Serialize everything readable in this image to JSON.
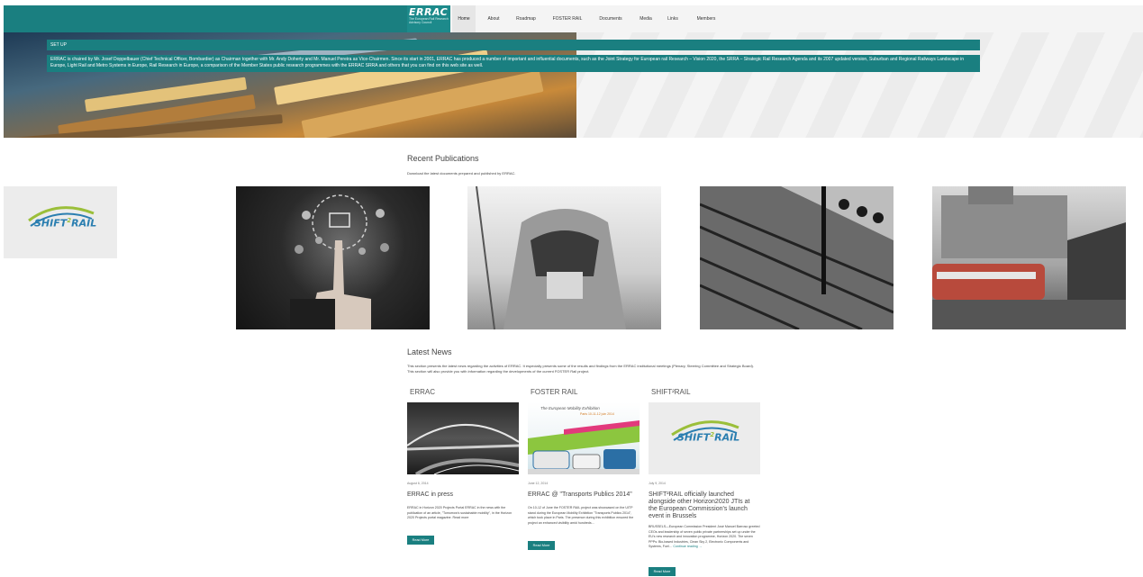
{
  "header": {
    "logo_brand": "ERRAC",
    "logo_tagline": "The European Rail Research Advisory Council",
    "nav": [
      "Home",
      "About",
      "Roadmap",
      "FOSTER RAIL",
      "Documents",
      "Media",
      "Links",
      "Members"
    ]
  },
  "hero": {
    "setup_label": "SET UP",
    "setup_text": "ERRAC is chaired by Mr. Josef Doppelbauer (Chief Technical Officer, Bombardier) as Chairman together with Mr. Andy Doherty and Mr. Manuel Pereira as Vice-Chairmen. Since its start in 2001, ERRAC has produced a number of important and influential documents, such as the Joint Strategy for European rail Research – Vision 2020, the SRRA – Strategic Rail Research Agenda and its 2007 updated version, Suburban and Regional Railways Landscape in Europe, Light Rail and Metro Systems in Europe, Rail Research in Europe, a comparison of the Member States public research programmes with the ERRAC SRRA and others that you can find on this web site as well."
  },
  "side_logo": {
    "text_main": "SHIFT",
    "text_sup": "2",
    "text_tail": "RAIL"
  },
  "publications": {
    "title": "Recent Publications",
    "subtitle": "Download the latest documents prepared and published by ERRAC."
  },
  "news": {
    "title": "Latest News",
    "intro": "This section presents the latest news regarding the activities of ERRAC. It especially presents some of the results and findings from the ERRAC institutional meetings (Plenary, Steering Committee and Strategic Board). This section will also provide you with information regarding the developments of the current FOSTER Rail project.",
    "columns": [
      {
        "head": "ERRAC",
        "date": "August 6, 2014",
        "title": "ERRAC in press",
        "body": "ERRAC in Horizon 2020 Projects Portal ERRAC in the news with the publication of an article, \"Tomorrow's sustainable mobility\", in the Horizon 2020 Projects portal magazine. Read more",
        "button": "Read More"
      },
      {
        "head": "FOSTER RAIL",
        "date": "June 12, 2014",
        "title": "ERRAC @ \"Transports Publics 2014\"",
        "body": "On 10-12 of June the FOSTER RAIL project was showcased on the UITP stand during the European Mobility Exhibition \"Transports Publics 2014\", which took place in Paris. The presence during this exhibition ensured the project an enhanced visibility amid hundreds...",
        "button": "Read More",
        "image_caption_1": "The European Mobility Exhibition",
        "image_caption_2": "Paris 10-11-12 juin 2014"
      },
      {
        "head": "SHIFT²RAIL",
        "date": "July 9, 2014",
        "title": "SHIFT²RAIL officially launched alongside other Horizon2020 JTIs at the European Commission's launch event in Brussels",
        "body": "BRUSSELS—European Commission President José Manuel Barroso greeted CEOs and leadership of seven public private partnerships set up under the EU's new research and innovation programme, Horizon 2020. The seven PPPs: Bio-based Industries, Clean Sky 2, Electronic Components and Systems, Fuel…",
        "link": "Continue reading →",
        "button": "Read More"
      }
    ]
  },
  "colors": {
    "accent": "#1a7f80"
  }
}
